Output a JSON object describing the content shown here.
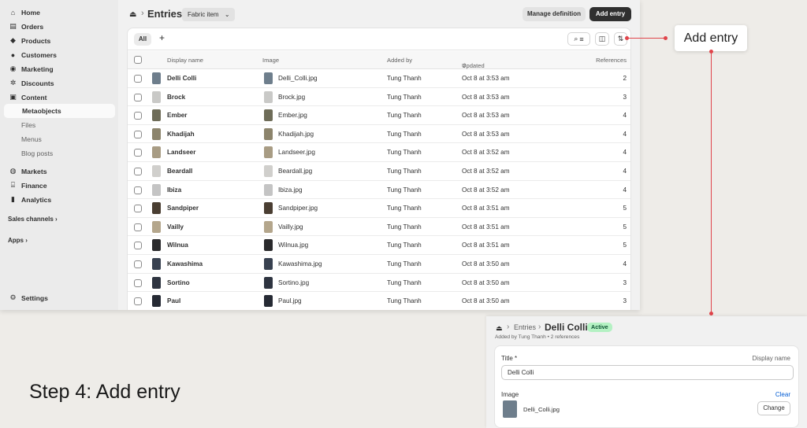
{
  "sidebar": {
    "items": [
      {
        "label": "Home",
        "icon": "home-icon"
      },
      {
        "label": "Orders",
        "icon": "orders-icon"
      },
      {
        "label": "Products",
        "icon": "tag-icon"
      },
      {
        "label": "Customers",
        "icon": "person-icon"
      },
      {
        "label": "Marketing",
        "icon": "target-icon"
      },
      {
        "label": "Discounts",
        "icon": "discount-icon"
      },
      {
        "label": "Content",
        "icon": "content-icon"
      },
      {
        "label": "Metaobjects"
      },
      {
        "label": "Files"
      },
      {
        "label": "Menus"
      },
      {
        "label": "Blog posts"
      },
      {
        "label": "Markets",
        "icon": "globe-icon"
      },
      {
        "label": "Finance",
        "icon": "bank-icon"
      },
      {
        "label": "Analytics",
        "icon": "chart-icon"
      }
    ],
    "sales_channels": "Sales channels ›",
    "apps": "Apps ›",
    "settings": "Settings"
  },
  "header": {
    "title": "Entries",
    "type_chip": "Fabric item",
    "manage_definition": "Manage definition",
    "add_entry": "Add entry"
  },
  "tabs": {
    "all": "All",
    "add": "+"
  },
  "table": {
    "columns": {
      "display_name": "Display name",
      "image": "Image",
      "added_by": "Added by",
      "updated": "Updated",
      "references": "References"
    },
    "rows": [
      {
        "name": "Delli Colli",
        "image": "Delli_Colli.jpg",
        "added_by": "Tung Thanh",
        "updated": "Oct 8 at 3:53 am",
        "refs": "2",
        "color": "#6e7e8c"
      },
      {
        "name": "Brock",
        "image": "Brock.jpg",
        "added_by": "Tung Thanh",
        "updated": "Oct 8 at 3:53 am",
        "refs": "3",
        "color": "#c9c9c7"
      },
      {
        "name": "Ember",
        "image": "Ember.jpg",
        "added_by": "Tung Thanh",
        "updated": "Oct 8 at 3:53 am",
        "refs": "4",
        "color": "#6e6c58"
      },
      {
        "name": "Khadijah",
        "image": "Khadijah.jpg",
        "added_by": "Tung Thanh",
        "updated": "Oct 8 at 3:53 am",
        "refs": "4",
        "color": "#8c846c"
      },
      {
        "name": "Landseer",
        "image": "Landseer.jpg",
        "added_by": "Tung Thanh",
        "updated": "Oct 8 at 3:52 am",
        "refs": "4",
        "color": "#a89c84"
      },
      {
        "name": "Beardall",
        "image": "Beardall.jpg",
        "added_by": "Tung Thanh",
        "updated": "Oct 8 at 3:52 am",
        "refs": "4",
        "color": "#d0cfcc"
      },
      {
        "name": "Ibiza",
        "image": "Ibiza.jpg",
        "added_by": "Tung Thanh",
        "updated": "Oct 8 at 3:52 am",
        "refs": "4",
        "color": "#c4c4c4"
      },
      {
        "name": "Sandpiper",
        "image": "Sandpiper.jpg",
        "added_by": "Tung Thanh",
        "updated": "Oct 8 at 3:51 am",
        "refs": "5",
        "color": "#4a3e32"
      },
      {
        "name": "Vailly",
        "image": "Vailly.jpg",
        "added_by": "Tung Thanh",
        "updated": "Oct 8 at 3:51 am",
        "refs": "5",
        "color": "#b4a68c"
      },
      {
        "name": "Wilnua",
        "image": "Wilnua.jpg",
        "added_by": "Tung Thanh",
        "updated": "Oct 8 at 3:51 am",
        "refs": "5",
        "color": "#2a2a2c"
      },
      {
        "name": "Kawashima",
        "image": "Kawashima.jpg",
        "added_by": "Tung Thanh",
        "updated": "Oct 8 at 3:50 am",
        "refs": "4",
        "color": "#384150"
      },
      {
        "name": "Sortino",
        "image": "Sortino.jpg",
        "added_by": "Tung Thanh",
        "updated": "Oct 8 at 3:50 am",
        "refs": "3",
        "color": "#2e3440"
      },
      {
        "name": "Paul",
        "image": "Paul.jpg",
        "added_by": "Tung Thanh",
        "updated": "Oct 8 at 3:50 am",
        "refs": "3",
        "color": "#262a34"
      }
    ]
  },
  "callout": {
    "label": "Add entry",
    "accent": "#e0444a"
  },
  "step_label": "Step 4: Add entry",
  "detail": {
    "breadcrumb": "Entries",
    "title": "Delli Colli",
    "status": "Active",
    "subtitle": "Added by Tung Thanh • 2 references",
    "field_title_label": "Title *",
    "field_title_hint": "Display name",
    "field_title_value": "Delli Colli",
    "image_label": "Image",
    "clear": "Clear",
    "file": "Delli_Colli.jpg",
    "change": "Change",
    "thumb_color": "#6e7e8c"
  }
}
